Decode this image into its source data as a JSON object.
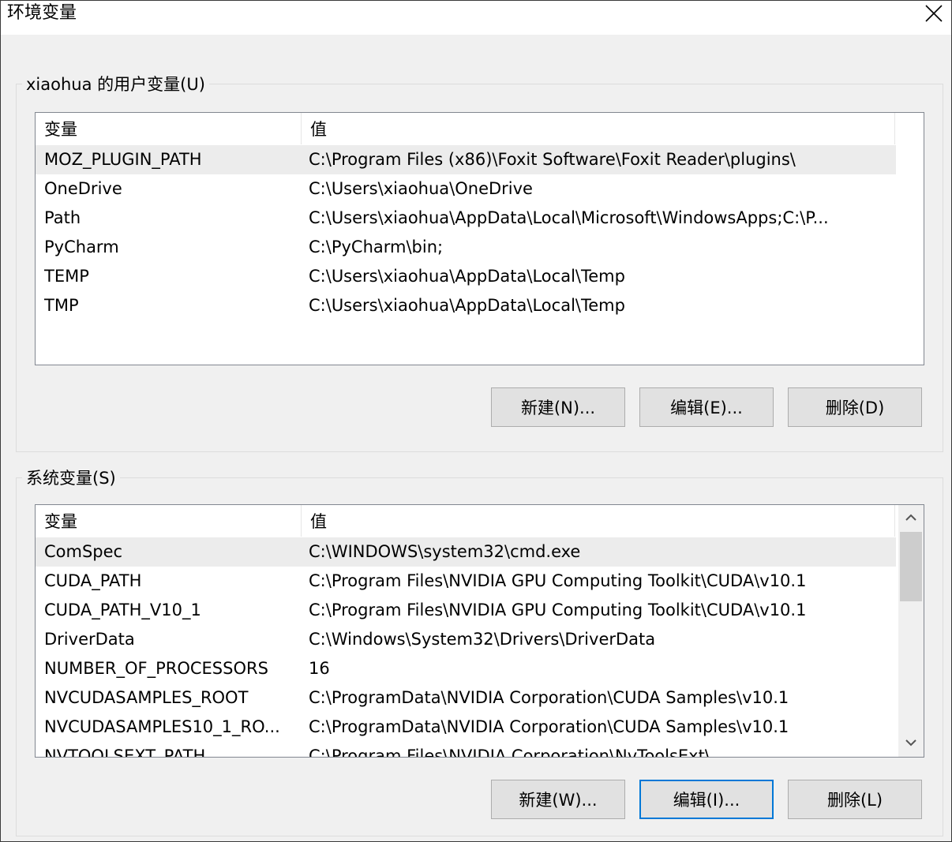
{
  "window": {
    "title": "环境变量"
  },
  "user_group": {
    "label": "xiaohua 的用户变量(U)",
    "columns": {
      "name": "变量",
      "value": "值"
    },
    "rows": [
      {
        "name": "MOZ_PLUGIN_PATH",
        "value": "C:\\Program Files (x86)\\Foxit Software\\Foxit Reader\\plugins\\"
      },
      {
        "name": "OneDrive",
        "value": "C:\\Users\\xiaohua\\OneDrive"
      },
      {
        "name": "Path",
        "value": "C:\\Users\\xiaohua\\AppData\\Local\\Microsoft\\WindowsApps;C:\\P..."
      },
      {
        "name": "PyCharm",
        "value": "C:\\PyCharm\\bin;"
      },
      {
        "name": "TEMP",
        "value": "C:\\Users\\xiaohua\\AppData\\Local\\Temp"
      },
      {
        "name": "TMP",
        "value": "C:\\Users\\xiaohua\\AppData\\Local\\Temp"
      }
    ],
    "buttons": {
      "new": "新建(N)...",
      "edit": "编辑(E)...",
      "delete": "删除(D)"
    }
  },
  "system_group": {
    "label": "系统变量(S)",
    "columns": {
      "name": "变量",
      "value": "值"
    },
    "rows": [
      {
        "name": "ComSpec",
        "value": "C:\\WINDOWS\\system32\\cmd.exe"
      },
      {
        "name": "CUDA_PATH",
        "value": "C:\\Program Files\\NVIDIA GPU Computing Toolkit\\CUDA\\v10.1"
      },
      {
        "name": "CUDA_PATH_V10_1",
        "value": "C:\\Program Files\\NVIDIA GPU Computing Toolkit\\CUDA\\v10.1"
      },
      {
        "name": "DriverData",
        "value": "C:\\Windows\\System32\\Drivers\\DriverData"
      },
      {
        "name": "NUMBER_OF_PROCESSORS",
        "value": "16"
      },
      {
        "name": "NVCUDASAMPLES_ROOT",
        "value": "C:\\ProgramData\\NVIDIA Corporation\\CUDA Samples\\v10.1"
      },
      {
        "name": "NVCUDASAMPLES10_1_RO...",
        "value": "C:\\ProgramData\\NVIDIA Corporation\\CUDA Samples\\v10.1"
      },
      {
        "name": "NVTOOLSEXT_PATH",
        "value": "C:\\Program Files\\NVIDIA Corporation\\NvToolsExt\\"
      }
    ],
    "buttons": {
      "new": "新建(W)...",
      "edit": "编辑(I)...",
      "delete": "删除(L)"
    }
  },
  "colors": {
    "accent": "#0078d7",
    "selected_row": "#ececec",
    "button_face": "#e1e1e1"
  },
  "icons": {
    "close": "close-icon",
    "scroll_up": "chevron-up-icon",
    "scroll_down": "chevron-down-icon"
  }
}
